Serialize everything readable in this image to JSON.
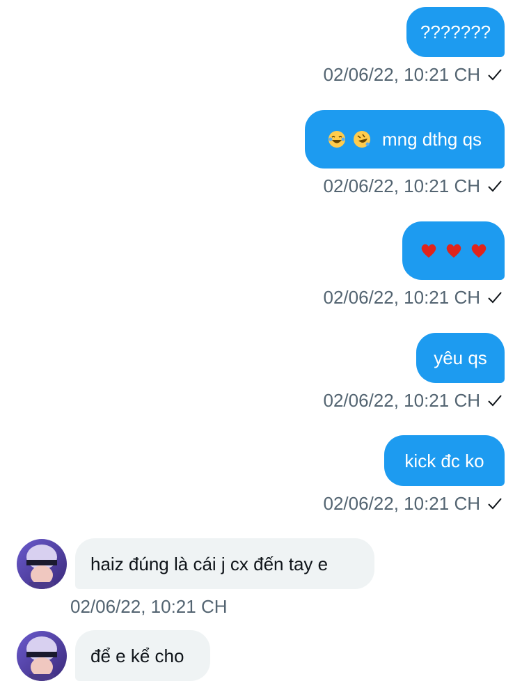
{
  "messages": [
    {
      "direction": "out",
      "text": "???????",
      "time": "02/06/22, 10:21 CH"
    },
    {
      "direction": "out",
      "emojis": [
        "laughing-tears-emoji",
        "rofl-emoji"
      ],
      "text": "mng dthg qs",
      "time": "02/06/22, 10:21 CH"
    },
    {
      "direction": "out",
      "emojis": [
        "red-heart-emoji",
        "red-heart-emoji",
        "red-heart-emoji"
      ],
      "text": "",
      "time": "02/06/22, 10:21 CH"
    },
    {
      "direction": "out",
      "text": "yêu qs",
      "time": "02/06/22, 10:21 CH"
    },
    {
      "direction": "out",
      "text": "kick đc ko",
      "time": "02/06/22, 10:21 CH"
    },
    {
      "direction": "in",
      "text": "haiz đúng là cái j cx đến tay e",
      "time": "02/06/22, 10:21 CH"
    },
    {
      "direction": "in",
      "text": "để e kể cho",
      "time": ""
    }
  ],
  "colors": {
    "outgoing_bubble": "#1d9bf0",
    "incoming_bubble": "#eff3f4",
    "timestamp": "#536471"
  },
  "icons": {
    "sent_status": "check-icon",
    "avatar": "contact-avatar"
  }
}
